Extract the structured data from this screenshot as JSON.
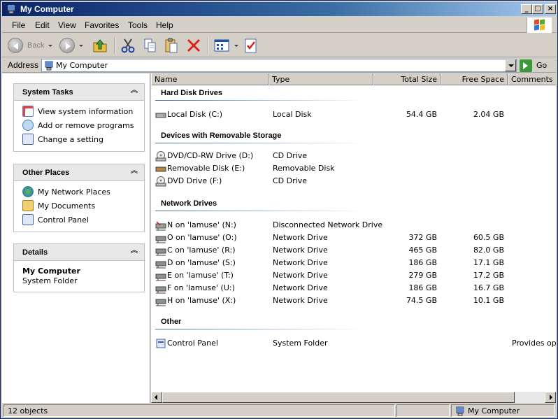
{
  "window": {
    "title": "My Computer"
  },
  "menu": [
    "File",
    "Edit",
    "View",
    "Favorites",
    "Tools",
    "Help"
  ],
  "toolbar": {
    "back_label": "Back"
  },
  "address": {
    "label": "Address",
    "value": "My Computer",
    "go_label": "Go"
  },
  "left": {
    "system_tasks": {
      "title": "System Tasks",
      "items": [
        "View system information",
        "Add or remove programs",
        "Change a setting"
      ]
    },
    "other_places": {
      "title": "Other Places",
      "items": [
        "My Network Places",
        "My Documents",
        "Control Panel"
      ]
    },
    "details": {
      "title": "Details",
      "name": "My Computer",
      "type": "System Folder"
    }
  },
  "columns": [
    "Name",
    "Type",
    "Total Size",
    "Free Space",
    "Comments"
  ],
  "groups": [
    {
      "title": "Hard Disk Drives",
      "items": [
        {
          "name": "Local Disk (C:)",
          "type": "Local Disk",
          "total": "54.4 GB",
          "free": "2.04 GB",
          "comment": ""
        }
      ]
    },
    {
      "title": "Devices with Removable Storage",
      "items": [
        {
          "name": "DVD/CD-RW Drive (D:)",
          "type": "CD Drive",
          "total": "",
          "free": "",
          "comment": ""
        },
        {
          "name": "Removable Disk (E:)",
          "type": "Removable Disk",
          "total": "",
          "free": "",
          "comment": ""
        },
        {
          "name": "DVD Drive (F:)",
          "type": "CD Drive",
          "total": "",
          "free": "",
          "comment": ""
        }
      ]
    },
    {
      "title": "Network Drives",
      "items": [
        {
          "name": "N on 'lamuse' (N:)",
          "type": "Disconnected Network Drive",
          "total": "",
          "free": "",
          "comment": ""
        },
        {
          "name": "O on 'lamuse' (O:)",
          "type": "Network Drive",
          "total": "372 GB",
          "free": "60.5 GB",
          "comment": ""
        },
        {
          "name": "C on 'lamuse' (R:)",
          "type": "Network Drive",
          "total": "465 GB",
          "free": "82.0 GB",
          "comment": ""
        },
        {
          "name": "D on 'lamuse' (S:)",
          "type": "Network Drive",
          "total": "186 GB",
          "free": "17.1 GB",
          "comment": ""
        },
        {
          "name": "E on 'lamuse' (T:)",
          "type": "Network Drive",
          "total": "279 GB",
          "free": "17.2 GB",
          "comment": ""
        },
        {
          "name": "F on 'lamuse' (U:)",
          "type": "Network Drive",
          "total": "186 GB",
          "free": "16.7 GB",
          "comment": ""
        },
        {
          "name": "H on 'lamuse' (X:)",
          "type": "Network Drive",
          "total": "74.5 GB",
          "free": "10.1 GB",
          "comment": ""
        }
      ]
    },
    {
      "title": "Other",
      "items": [
        {
          "name": "Control Panel",
          "type": "System Folder",
          "total": "",
          "free": "",
          "comment": "Provides optio"
        }
      ]
    }
  ],
  "status": {
    "objects": "12 objects",
    "location": "My Computer"
  }
}
